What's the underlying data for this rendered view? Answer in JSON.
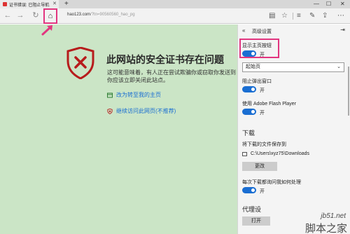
{
  "tab": {
    "title": "证书错误: 已阻止导航"
  },
  "addressbar": {
    "url_host": "hao123.com",
    "url_path": "/?tn=90560560_hao_pg"
  },
  "page": {
    "title": "此网站的安全证书存在问题",
    "desc": [
      "这可能意味着，有人正在尝试欺骗你或窃取你发送到",
      "你应该立即关闭此站点。"
    ],
    "link_home": "改为转至我的主页",
    "link_continue": "继续访问此网页(不推荐)"
  },
  "settings": {
    "header": "高级设置",
    "show_home_label": "显示主页按钮",
    "show_home_state": "开",
    "homepage_select": "起始页",
    "popup_label": "阻止弹出窗口",
    "popup_state": "开",
    "flash_label": "使用 Adobe Flash Player",
    "flash_state": "开",
    "download_title": "下载",
    "download_location_label": "将下载的文件保存到",
    "download_path": "C:\\Users\\xyz75\\Downloads",
    "change_button": "更改",
    "ask_label": "每次下载都询问我如何处理",
    "ask_state": "开",
    "proxy_title": "代理设",
    "open_button": "打开"
  },
  "watermark": {
    "top": "jb51.net",
    "bottom": "脚本之家"
  },
  "colors": {
    "accent": "#1a6ed2",
    "annotation": "#e2357f",
    "error_red": "#b71c1c",
    "page_bg": "#cbe5c6"
  }
}
